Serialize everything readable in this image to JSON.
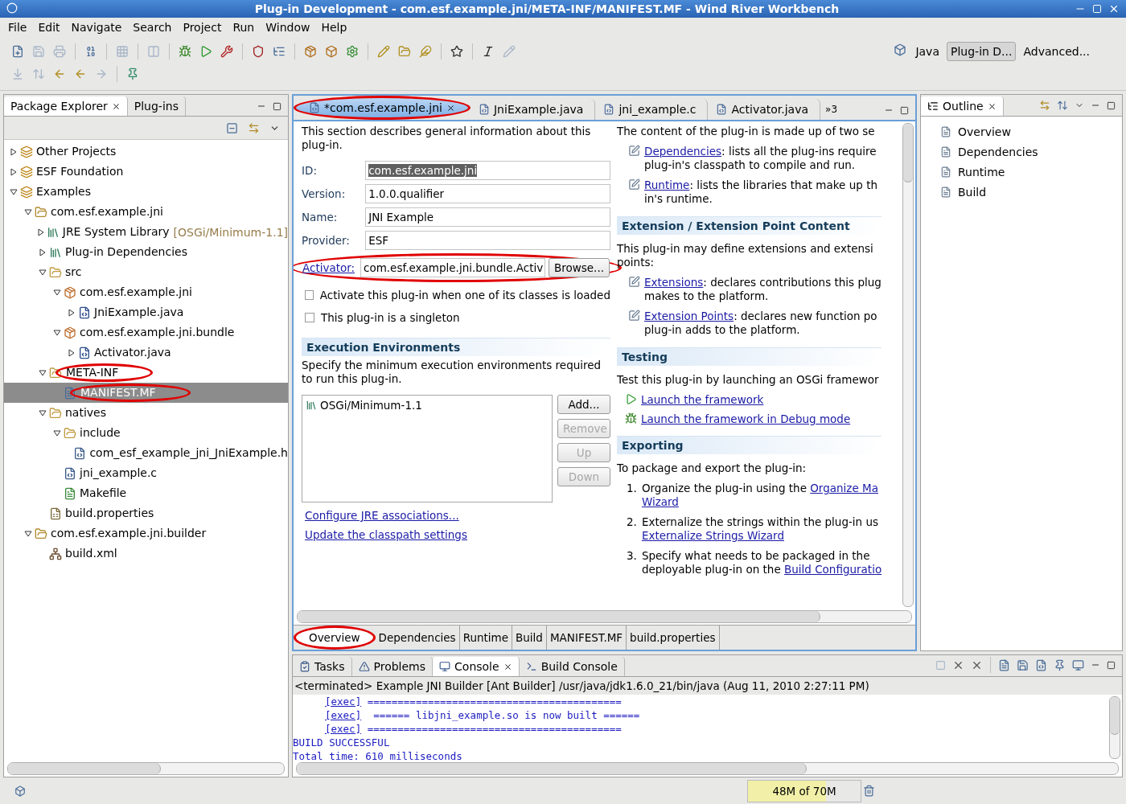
{
  "window": {
    "title": "Plug-in Development - com.esf.example.jni/META-INF/MANIFEST.MF - Wind River Workbench"
  },
  "menu": [
    "File",
    "Edit",
    "Navigate",
    "Search",
    "Project",
    "Run",
    "Window",
    "Help"
  ],
  "perspectives": [
    {
      "label": "Java",
      "selected": false
    },
    {
      "label": "Plug-in D...",
      "selected": true
    },
    {
      "label": "Advanced...",
      "selected": false
    }
  ],
  "left_panel": {
    "tabs": [
      {
        "label": "Package Explorer",
        "selected": true
      },
      {
        "label": "Plug-ins",
        "selected": false
      }
    ],
    "tree": [
      {
        "label": "Other Projects",
        "kind": "working-set",
        "expanded": false,
        "selected": false
      },
      {
        "label": "ESF Foundation",
        "kind": "working-set",
        "expanded": false,
        "selected": false
      },
      {
        "label": "Examples",
        "kind": "working-set",
        "expanded": true,
        "selected": false,
        "children": [
          {
            "label": "com.esf.example.jni",
            "kind": "project",
            "expanded": true,
            "selected": false,
            "children": [
              {
                "label": "JRE System Library",
                "decoration": "[OSGi/Minimum-1.1]",
                "kind": "library",
                "expanded": false,
                "selected": false
              },
              {
                "label": "Plug-in Dependencies",
                "kind": "library",
                "expanded": false,
                "selected": false
              },
              {
                "label": "src",
                "kind": "folder",
                "expanded": true,
                "selected": false,
                "children": [
                  {
                    "label": "com.esf.example.jni",
                    "kind": "package",
                    "expanded": true,
                    "selected": false,
                    "children": [
                      {
                        "label": "JniExample.java",
                        "kind": "java",
                        "expanded": false,
                        "selected": false
                      }
                    ]
                  },
                  {
                    "label": "com.esf.example.jni.bundle",
                    "kind": "package",
                    "expanded": true,
                    "selected": false,
                    "children": [
                      {
                        "label": "Activator.java",
                        "kind": "java",
                        "expanded": false,
                        "selected": false
                      }
                    ]
                  }
                ]
              },
              {
                "label": "META-INF",
                "kind": "folder",
                "expanded": true,
                "selected": false,
                "circled": true,
                "children": [
                  {
                    "label": "MANIFEST.MF",
                    "kind": "manifest",
                    "selected": true,
                    "circled": true
                  }
                ]
              },
              {
                "label": "natives",
                "kind": "folder",
                "expanded": true,
                "selected": false,
                "children": [
                  {
                    "label": "include",
                    "kind": "folder",
                    "expanded": true,
                    "selected": false,
                    "children": [
                      {
                        "label": "com_esf_example_jni_JniExample.h",
                        "kind": "c",
                        "selected": false
                      }
                    ]
                  },
                  {
                    "label": "jni_example.c",
                    "kind": "c",
                    "selected": false
                  },
                  {
                    "label": "Makefile",
                    "kind": "make",
                    "selected": false
                  }
                ]
              },
              {
                "label": "build.properties",
                "kind": "properties",
                "selected": false
              }
            ]
          },
          {
            "label": "com.esf.example.jni.builder",
            "kind": "project",
            "expanded": true,
            "selected": false,
            "children": [
              {
                "label": "build.xml",
                "kind": "xml",
                "selected": false
              }
            ]
          }
        ]
      }
    ]
  },
  "editor": {
    "tabs": [
      {
        "label": "*com.esf.example.jni",
        "selected": true,
        "circled": true
      },
      {
        "label": "JniExample.java",
        "selected": false,
        "circled": false
      },
      {
        "label": "jni_example.c",
        "selected": false,
        "circled": false
      },
      {
        "label": "Activator.java",
        "selected": false,
        "circled": false
      }
    ],
    "overflow": "»3",
    "general": {
      "description": "This section describes general information about this plug-in.",
      "fields": [
        {
          "label": "ID:",
          "value": "com.esf.example.jni",
          "label_link": false,
          "text_selected": true,
          "circled": false
        },
        {
          "label": "Version:",
          "value": "1.0.0.qualifier",
          "label_link": false,
          "text_selected": false,
          "circled": false
        },
        {
          "label": "Name:",
          "value": "JNI Example",
          "label_link": false,
          "text_selected": false,
          "circled": false
        },
        {
          "label": "Provider:",
          "value": "ESF",
          "label_link": false,
          "text_selected": false,
          "circled": false
        },
        {
          "label": "Activator:",
          "value": "com.esf.example.jni.bundle.Activ",
          "label_link": true,
          "text_selected": false,
          "circled": true,
          "button": "Browse..."
        }
      ],
      "checkboxes": [
        {
          "label": "Activate this plug-in when one of its classes is loaded",
          "checked": false
        },
        {
          "label": "This plug-in is a singleton",
          "checked": false
        }
      ]
    },
    "execution": {
      "title": "Execution Environments",
      "description": "Specify the minimum execution environments required to run this plug-in.",
      "items": [
        "OSGi/Minimum-1.1"
      ],
      "buttons": [
        {
          "label": "Add...",
          "disabled": false
        },
        {
          "label": "Remove",
          "disabled": true
        },
        {
          "label": "Up",
          "disabled": true
        },
        {
          "label": "Down",
          "disabled": true
        }
      ],
      "links": [
        "Configure JRE associations...",
        "Update the classpath settings"
      ]
    },
    "sections": [
      {
        "kind": "content",
        "paragraph": [
          "The content of the plug-in is made up of two se"
        ],
        "items": [
          {
            "link": "Dependencies",
            "text": ": lists all the plug-ins require",
            "continuation": "plug-in's classpath to compile and run."
          },
          {
            "link": "Runtime",
            "text": ": lists the libraries that make up th",
            "continuation": "in's runtime."
          }
        ]
      },
      {
        "kind": "titled",
        "title": "Extension / Extension Point Content",
        "paragraph": [
          "This plug-in may define extensions and extensi",
          "points:"
        ],
        "items": [
          {
            "link": "Extensions",
            "text": ": declares contributions this plug",
            "continuation": "makes to the platform."
          },
          {
            "link": "Extension Points",
            "text": ": declares new function po",
            "continuation": "plug-in adds to the platform."
          }
        ]
      },
      {
        "kind": "titled",
        "title": "Testing",
        "paragraph": [
          "Test this plug-in by launching an OSGi framewor"
        ],
        "actions": [
          {
            "kind": "run",
            "link": "Launch the framework"
          },
          {
            "kind": "debug",
            "link": "Launch the framework in Debug mode"
          }
        ]
      },
      {
        "kind": "titled",
        "title": "Exporting",
        "paragraph": [
          "To package and export the plug-in:"
        ],
        "steps": [
          {
            "number": "1.",
            "lines": [
              [
                {
                  "text": "Organize the plug-in using the "
                },
                {
                  "link": "Organize Ma"
                }
              ],
              [
                {
                  "link": "Wizard"
                }
              ]
            ]
          },
          {
            "number": "2.",
            "lines": [
              [
                {
                  "text": "Externalize the strings within the plug-in us"
                }
              ],
              [
                {
                  "link": "Externalize Strings Wizard"
                }
              ]
            ]
          },
          {
            "number": "3.",
            "lines": [
              [
                {
                  "text": "Specify what needs to be packaged in the"
                }
              ],
              [
                {
                  "text": "deployable plug-in on the "
                },
                {
                  "link": "Build Configuratio"
                }
              ]
            ]
          }
        ]
      }
    ],
    "page_tabs": [
      {
        "label": "Overview",
        "selected": true,
        "circled": true
      },
      {
        "label": "Dependencies",
        "selected": false,
        "circled": false
      },
      {
        "label": "Runtime",
        "selected": false,
        "circled": false
      },
      {
        "label": "Build",
        "selected": false,
        "circled": false
      },
      {
        "label": "MANIFEST.MF",
        "selected": false,
        "circled": false
      },
      {
        "label": "build.properties",
        "selected": false,
        "circled": false
      }
    ]
  },
  "outline": {
    "title": "Outline",
    "items": [
      "Overview",
      "Dependencies",
      "Runtime",
      "Build"
    ]
  },
  "console": {
    "tabs": [
      {
        "label": "Tasks",
        "selected": false
      },
      {
        "label": "Problems",
        "selected": false
      },
      {
        "label": "Console",
        "selected": true
      },
      {
        "label": "Build Console",
        "selected": false
      }
    ],
    "header": "<terminated> Example JNI Builder [Ant Builder] /usr/java/jdk1.6.0_21/bin/java (Aug 11, 2010 2:27:11 PM)",
    "lines": [
      {
        "prefix": "[exec]",
        "text": " =========================================="
      },
      {
        "prefix": "[exec]",
        "text": "  ====== libjni_example.so is now built ======"
      },
      {
        "prefix": "[exec]",
        "text": " =========================================="
      },
      {
        "text": "BUILD SUCCESSFUL"
      },
      {
        "text": "Total time: 610 milliseconds"
      }
    ]
  },
  "status_bar": {
    "memory": {
      "reading": "48M of 70M",
      "level": 0.69
    }
  }
}
